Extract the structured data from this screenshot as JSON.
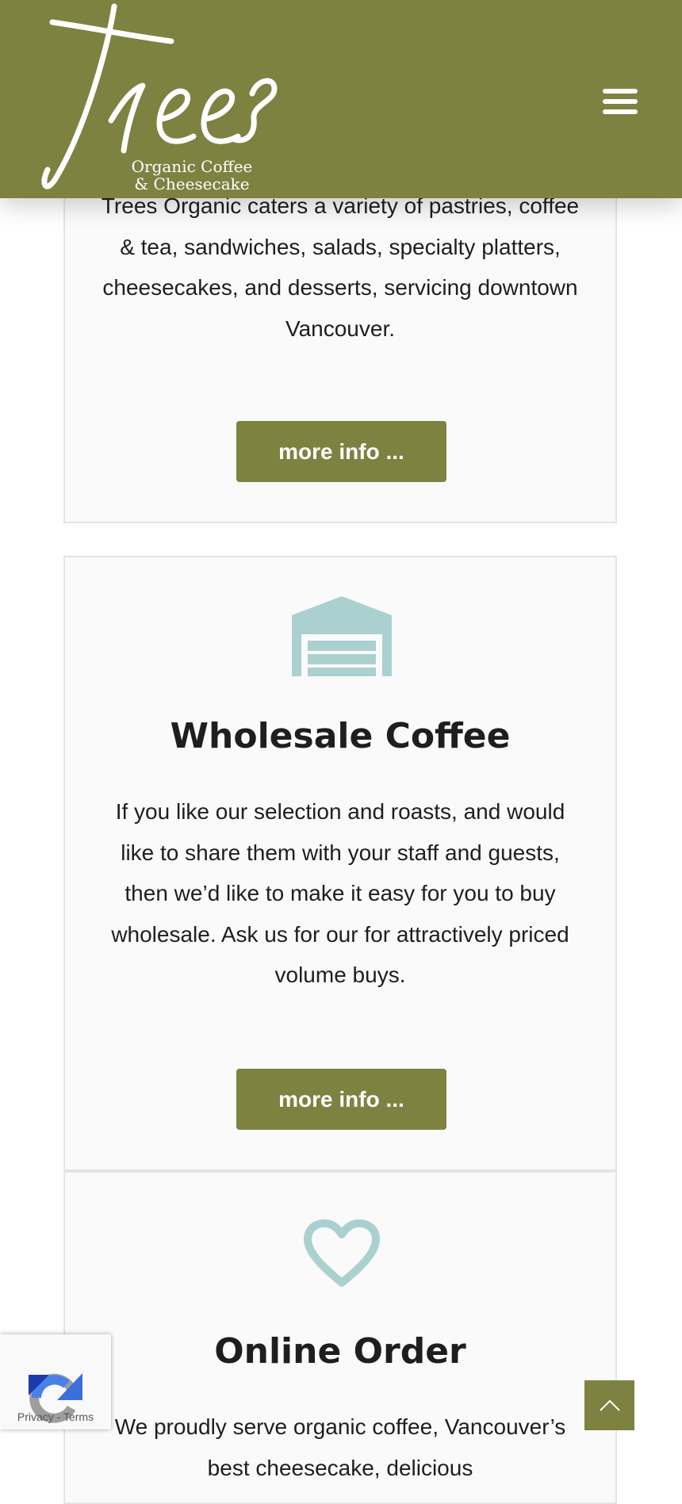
{
  "header": {
    "logo_word": "Trees",
    "logo_line1": "Organic Coffee",
    "logo_line2": "& Cheesecake",
    "menu_icon": "hamburger-menu-icon",
    "background": "#7d8240"
  },
  "cards": [
    {
      "id": "catering",
      "text": "Trees Organic caters a variety of pastries, coffee & tea, sandwiches, salads, specialty platters, cheesecakes, and desserts, servicing downtown Vancouver.",
      "button": "more info ..."
    },
    {
      "id": "wholesale",
      "icon": "warehouse-icon",
      "title": "Wholesale Coffee",
      "text": "If you like our selection and roasts, and would like to share them with your staff and guests, then we’d like to make it easy for you to buy wholesale. Ask us for our for attractively priced volume buys.",
      "button": "more info ..."
    },
    {
      "id": "online",
      "icon": "heart-icon",
      "title": "Online Order",
      "text": "We proudly serve organic coffee, Vancouver’s best cheesecake, delicious"
    }
  ],
  "recaptcha": {
    "privacy": "Privacy",
    "separator": "-",
    "terms": "Terms"
  },
  "scroll_top": {
    "icon": "chevron-up-icon"
  },
  "colors": {
    "accent": "#7d8240",
    "icon": "#abd0d0",
    "text": "#1e1e1e",
    "card_bg": "#fafafa"
  }
}
